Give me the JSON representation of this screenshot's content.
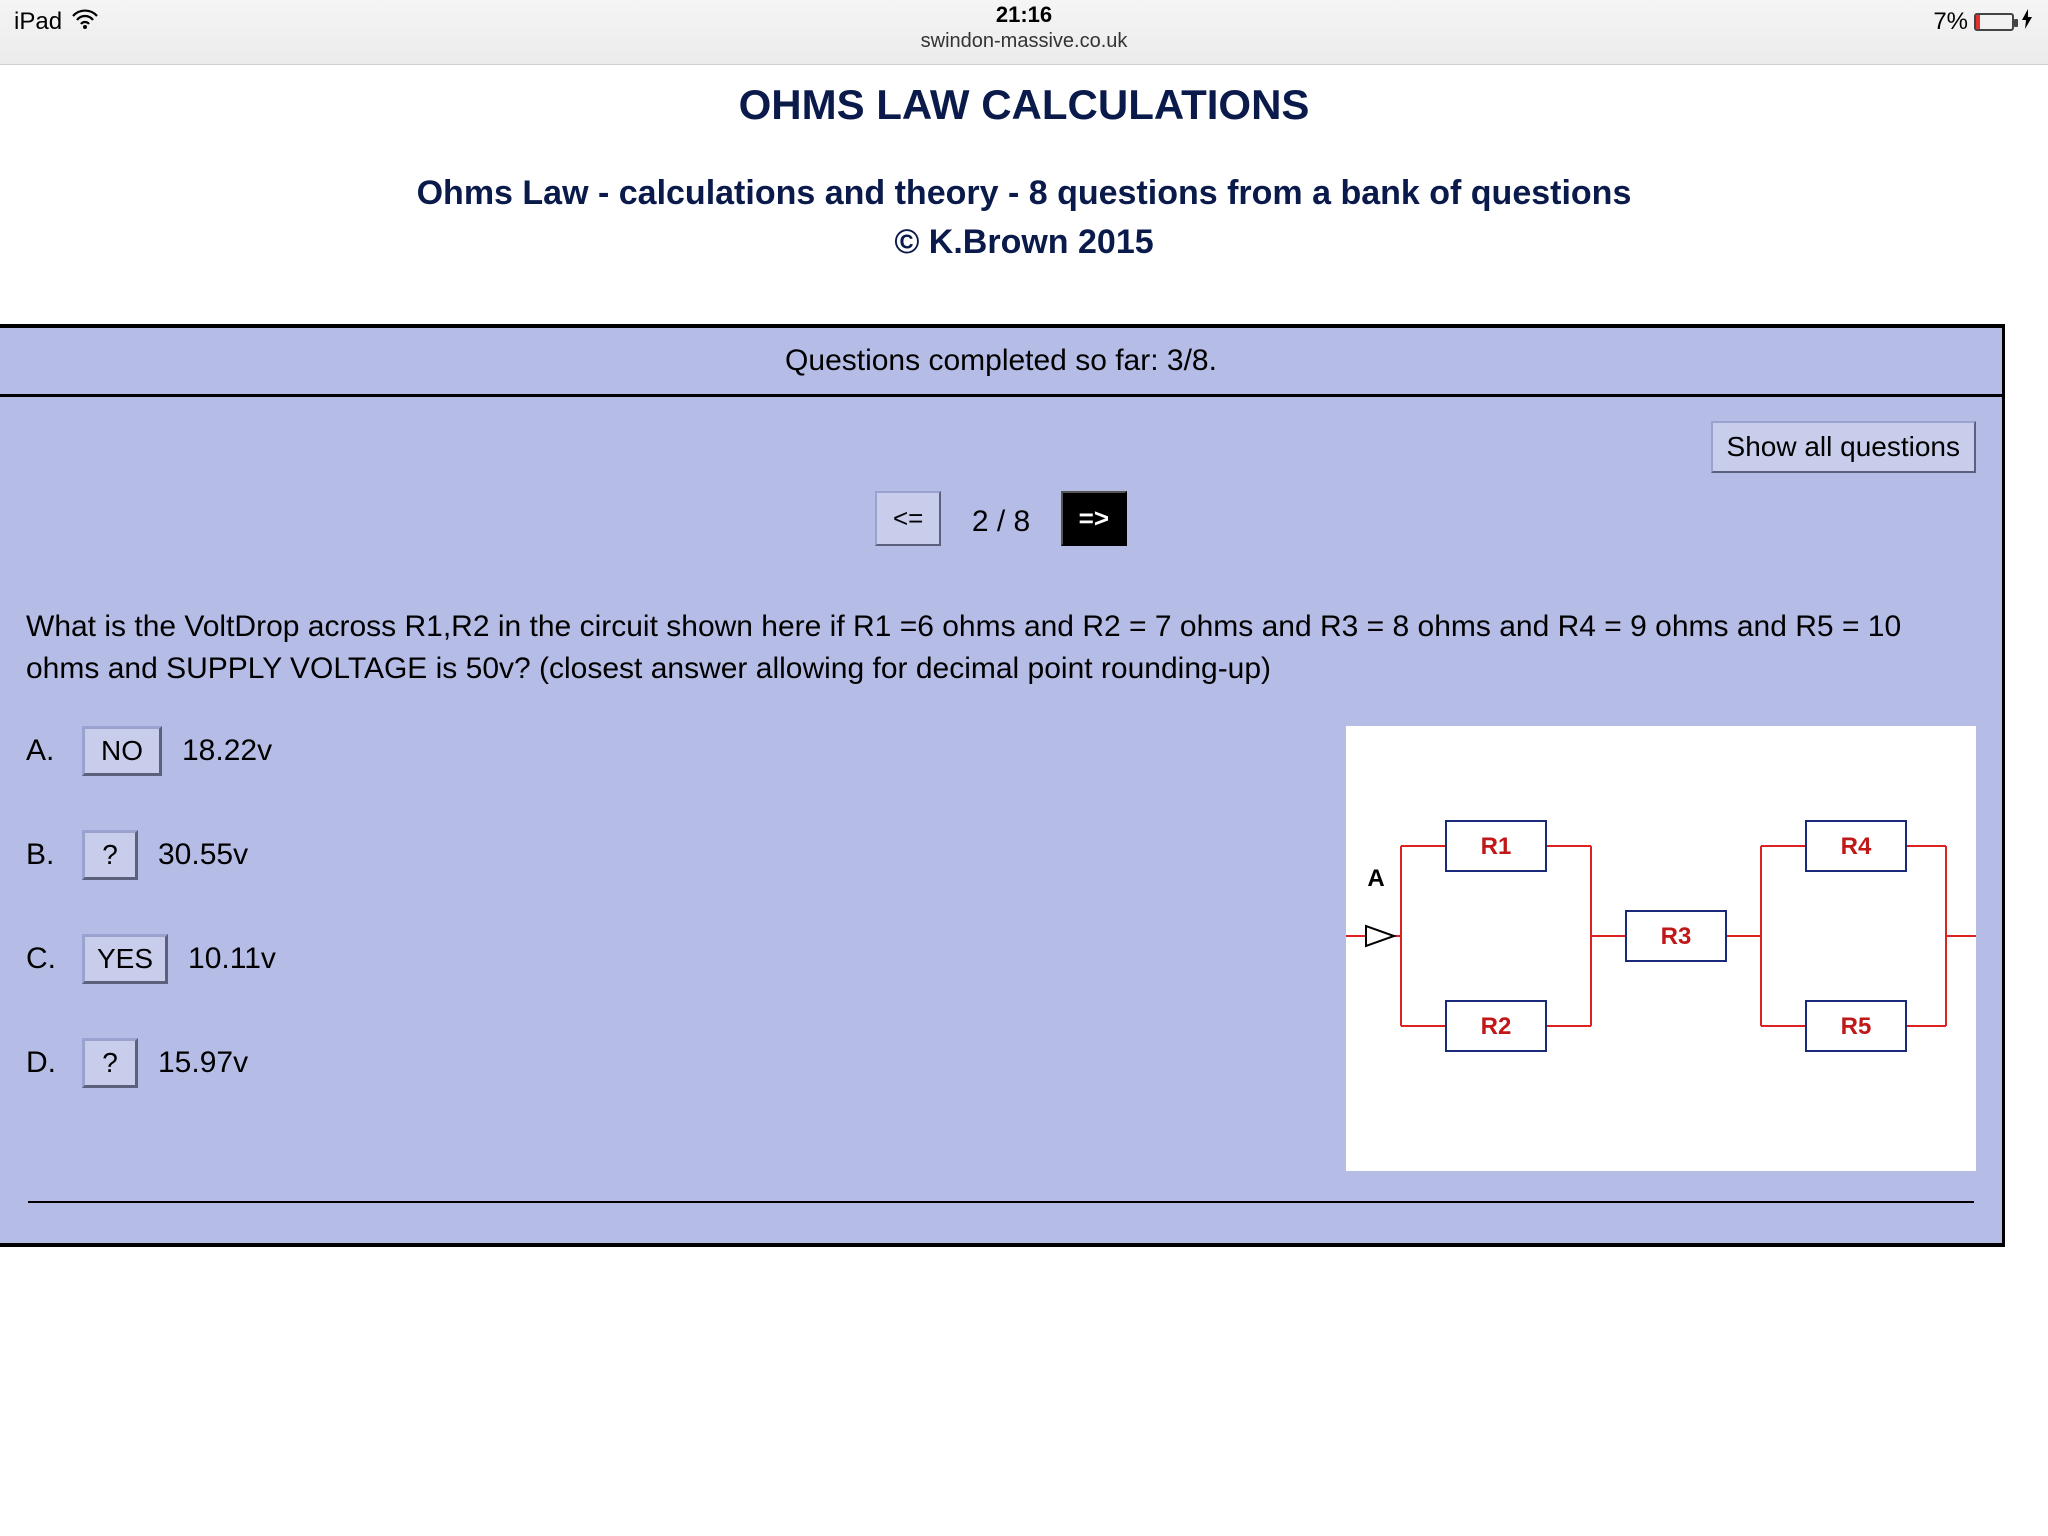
{
  "statusbar": {
    "device": "iPad",
    "time": "21:16",
    "domain": "swindon-massive.co.uk",
    "battery_pct": "7%"
  },
  "header": {
    "title": "OHMS LAW CALCULATIONS",
    "subtitle_line1": "Ohms Law - calculations and theory - 8 questions from a bank of questions",
    "subtitle_line2": "© K.Brown 2015"
  },
  "progress": {
    "text": "Questions completed so far: 3/8."
  },
  "controls": {
    "show_all": "Show all questions",
    "prev": "<=",
    "next": "=>",
    "counter": "2 / 8"
  },
  "question": {
    "text": "What is the VoltDrop across R1,R2 in the circuit shown here if R1 =6 ohms and R2 = 7 ohms and R3 = 8 ohms and R4 = 9 ohms and R5 = 10 ohms and SUPPLY VOLTAGE is 50v? (closest answer allowing for decimal point rounding-up)"
  },
  "answers": [
    {
      "letter": "A.",
      "state": "NO",
      "value": "18.22v"
    },
    {
      "letter": "B.",
      "state": "?",
      "value": "30.55v"
    },
    {
      "letter": "C.",
      "state": "YES",
      "value": "10.11v"
    },
    {
      "letter": "D.",
      "state": "?",
      "value": "15.97v"
    }
  ],
  "diagram": {
    "labels": {
      "A": "A",
      "R1": "R1",
      "R2": "R2",
      "R3": "R3",
      "R4": "R4",
      "R5": "R5"
    }
  }
}
